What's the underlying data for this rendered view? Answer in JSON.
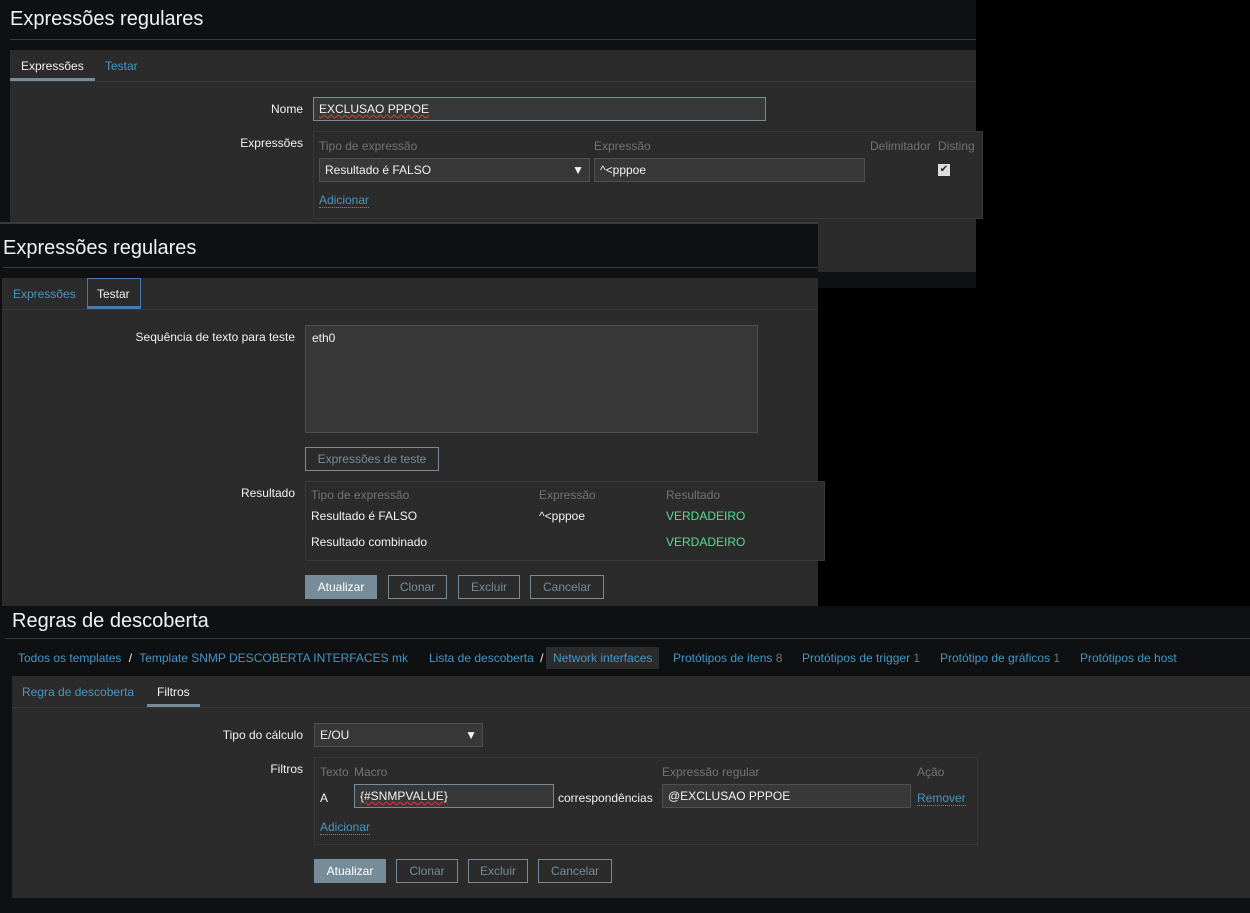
{
  "panel1": {
    "title": "Expressões regulares",
    "tabs": [
      "Expressões",
      "Testar"
    ],
    "name_label": "Nome",
    "name_value": "EXCLUSAO PPPOE",
    "expr_label": "Expressões",
    "cols": [
      "Tipo de expressão",
      "Expressão",
      "Delimitador",
      "Disting"
    ],
    "type_value": "Resultado é FALSO",
    "expr_value": "^<pppoe",
    "add": "Adicionar"
  },
  "panel2": {
    "title": "Expressões regulares",
    "tabs": [
      "Expressões",
      "Testar"
    ],
    "test_label": "Sequência de texto para teste",
    "test_value": "eth0",
    "test_button": "Expressões de teste",
    "result_label": "Resultado",
    "cols": [
      "Tipo de expressão",
      "Expressão",
      "Resultado"
    ],
    "rows": [
      [
        "Resultado é FALSO",
        "^<pppoe",
        "VERDADEIRO"
      ],
      [
        "Resultado combinado",
        "",
        "VERDADEIRO"
      ]
    ],
    "buttons": [
      "Atualizar",
      "Clonar",
      "Excluir",
      "Cancelar"
    ]
  },
  "panel3": {
    "title": "Regras de descoberta",
    "breadcrumb": [
      "Todos os templates",
      "Template SNMP DESCOBERTA INTERFACES mk",
      "Lista de descoberta",
      "Network interfaces"
    ],
    "nav": [
      {
        "label": "Protótipos de itens",
        "count": "8"
      },
      {
        "label": "Protótipos de trigger",
        "count": "1"
      },
      {
        "label": "Protótipo de gráficos",
        "count": "1"
      },
      {
        "label": "Protótipos de host",
        "count": ""
      }
    ],
    "tabs": [
      "Regra de descoberta",
      "Filtros"
    ],
    "calc_label": "Tipo do cálculo",
    "calc_value": "E/OU",
    "filters_label": "Filtros",
    "cols": [
      "Texto",
      "Macro",
      "Expressão regular",
      "Ação"
    ],
    "row": {
      "label": "A",
      "macro": "{#SNMPVALUE}",
      "op": "correspondências",
      "regex": "@EXCLUSAO PPPOE",
      "action": "Remover"
    },
    "add": "Adicionar",
    "buttons": [
      "Atualizar",
      "Clonar",
      "Excluir",
      "Cancelar"
    ]
  }
}
